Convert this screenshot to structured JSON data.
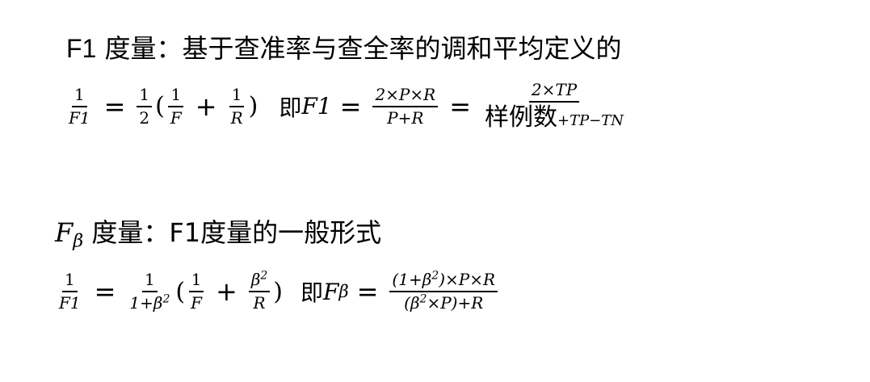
{
  "section1": {
    "heading_prefix": "F1",
    "heading_text": " 度量：基于查准率与查全率的调和平均定义的",
    "lhs_num": "1",
    "lhs_den": "F1",
    "eq1": "=",
    "half_num": "1",
    "half_den": "2",
    "paren_open": "(",
    "f_num": "1",
    "f_den": "F",
    "plus": "+",
    "r_num": "1",
    "r_den": "R",
    "paren_close": ")",
    "ji_text": "即",
    "ji_var": "F1",
    "eq2": "=",
    "mid_num": "2×P×R",
    "mid_den": "P+R",
    "eq3": "=",
    "right_num": "2×TP",
    "right_den_cn": "样例数",
    "right_den_sub": "+TP−TN"
  },
  "section2": {
    "heading_var": "F",
    "heading_sub": "β",
    "heading_text": " 度量：F1度量的一般形式",
    "lhs_num": "1",
    "lhs_den": "F1",
    "eq1": "=",
    "coef_num": "1",
    "coef_den_base": "1+β",
    "coef_den_exp": "2",
    "paren_open": "(",
    "f_num": "1",
    "f_den": "F",
    "plus": "+",
    "b_num_base": "β",
    "b_num_exp": "2",
    "b_den": "R",
    "paren_close": ")",
    "ji_text": "即",
    "ji_var": "F",
    "ji_sub": "β",
    "eq2": "=",
    "num_a": "(1+β",
    "num_exp": "2",
    "num_b": ")×P×R",
    "den_a": "(β",
    "den_exp": "2",
    "den_b": "×P)+R"
  }
}
